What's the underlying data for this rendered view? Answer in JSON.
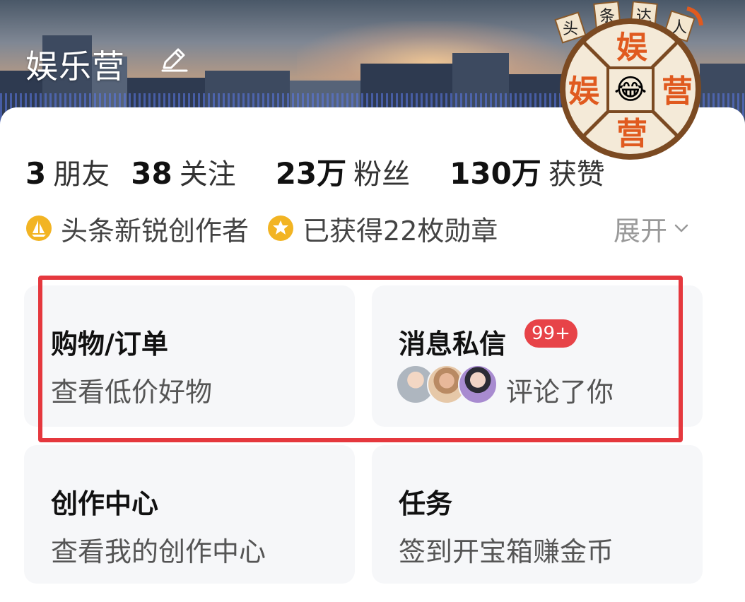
{
  "header": {
    "title": "娱乐营",
    "edit_icon": "pencil-icon",
    "logo": {
      "arc_text": [
        "头",
        "条",
        "达",
        "人"
      ],
      "center_chars": [
        "娱",
        "娱",
        "营",
        "营"
      ],
      "emoji": "😂"
    }
  },
  "stats": [
    {
      "value": "3",
      "label": "朋友"
    },
    {
      "value": "38",
      "label": "关注"
    },
    {
      "value": "23万",
      "label": "粉丝"
    },
    {
      "value": "130万",
      "label": "获赞"
    }
  ],
  "badges": [
    {
      "icon": "sailboat-icon",
      "text": "头条新锐创作者"
    },
    {
      "icon": "medal-star-icon",
      "text": "已获得22枚勋章"
    }
  ],
  "expand": {
    "label": "展开",
    "icon": "chevron-down-icon"
  },
  "tiles": {
    "shopping": {
      "title": "购物/订单",
      "subtitle": "查看低价好物"
    },
    "messages": {
      "title": "消息私信",
      "badge": "99+",
      "subtitle": "评论了你"
    },
    "creation": {
      "title": "创作中心",
      "subtitle": "查看我的创作中心"
    },
    "tasks": {
      "title": "任务",
      "subtitle": "签到开宝箱赚金币"
    }
  },
  "colors": {
    "highlight": "#e5383e",
    "badge": "#e74348",
    "tile_bg": "#f6f7f9",
    "logo_orange": "#e05a1f"
  }
}
